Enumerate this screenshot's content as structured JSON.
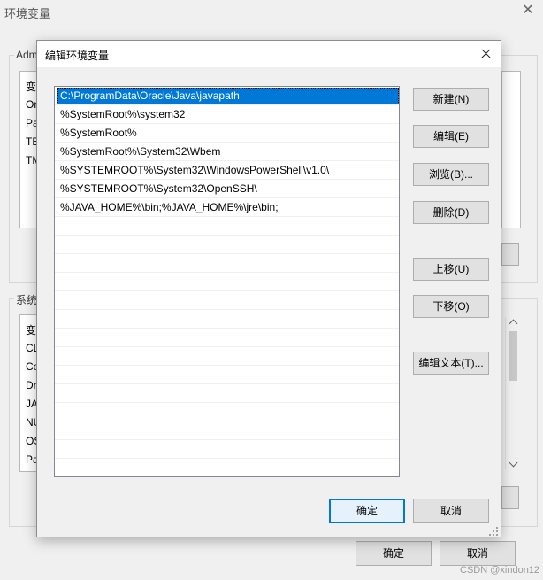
{
  "background_window": {
    "title": "环境变量",
    "user_group_label": "Adm",
    "user_list_rows": [
      "变",
      "Or",
      "Pa",
      "TE",
      "TM"
    ],
    "system_group_label": "系统",
    "system_list_rows": [
      "变",
      "CL",
      "Co",
      "Dr",
      "JA",
      "NU",
      "OS",
      "Pa"
    ],
    "ok_label": "确定",
    "cancel_label": "取消"
  },
  "dialog": {
    "title": "编辑环境变量",
    "list_items": [
      "C:\\ProgramData\\Oracle\\Java\\javapath",
      "%SystemRoot%\\system32",
      "%SystemRoot%",
      "%SystemRoot%\\System32\\Wbem",
      "%SYSTEMROOT%\\System32\\WindowsPowerShell\\v1.0\\",
      "%SYSTEMROOT%\\System32\\OpenSSH\\",
      "%JAVA_HOME%\\bin;%JAVA_HOME%\\jre\\bin;"
    ],
    "selected_index": 0,
    "buttons": {
      "new": "新建(N)",
      "edit": "编辑(E)",
      "browse": "浏览(B)...",
      "delete": "删除(D)",
      "move_up": "上移(U)",
      "move_down": "下移(O)",
      "edit_text": "编辑文本(T)...",
      "ok": "确定",
      "cancel": "取消"
    }
  },
  "watermark": "CSDN @xindon12",
  "colors": {
    "selection": "#0078d7",
    "window_bg": "#f0f0f0",
    "button_bg": "#e1e1e1"
  }
}
